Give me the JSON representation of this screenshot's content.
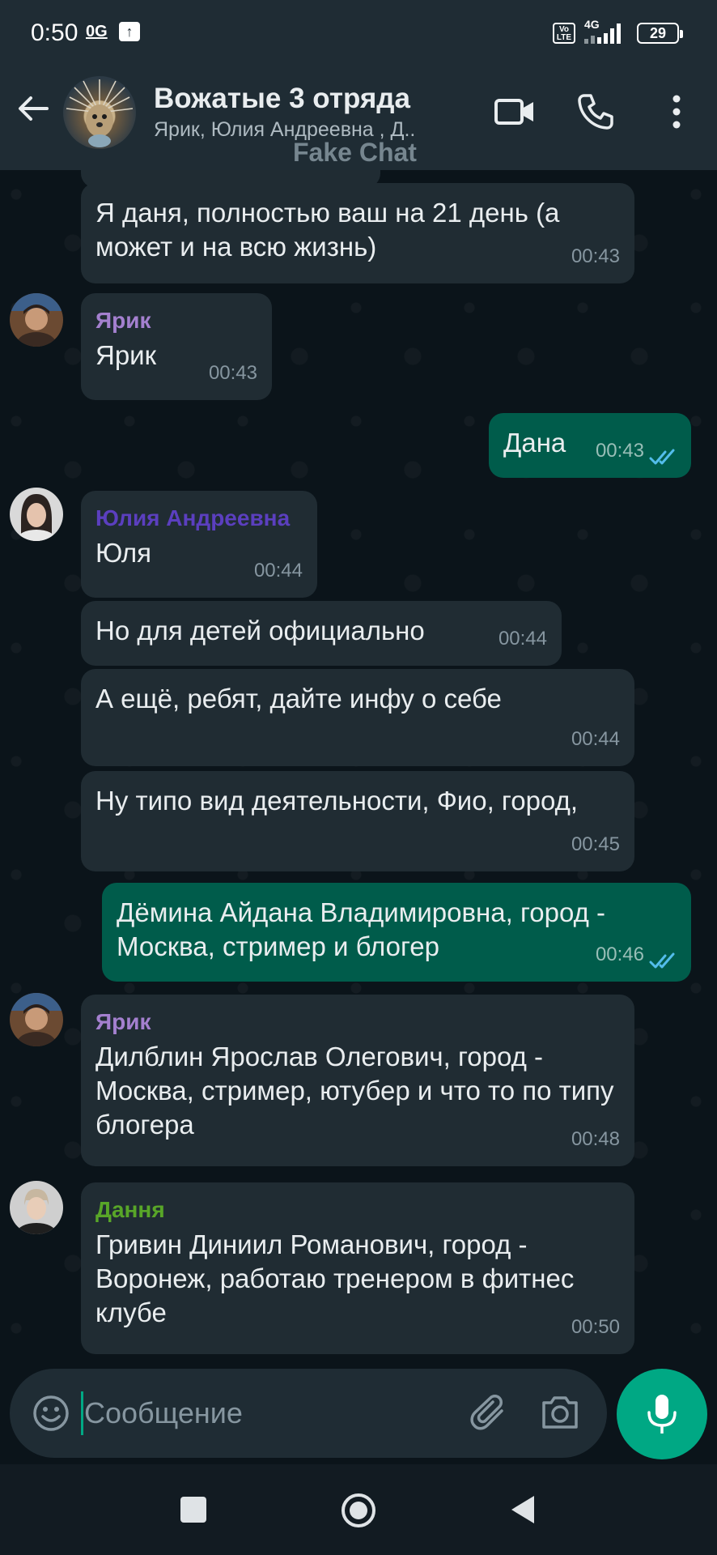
{
  "status_bar": {
    "time": "0:50",
    "og": "0G",
    "network": "4G",
    "volte": "Vo LTE",
    "battery": "29"
  },
  "header": {
    "title": "Вожатые 3 отряда",
    "members": "Ярик, Юлия Андреевна , Д..",
    "watermark": "Fake Chat"
  },
  "colors": {
    "incoming_bubble": "#202c33",
    "outgoing_bubble": "#005c4b",
    "accent": "#00a884",
    "sender_yarik": "#a480cf",
    "sender_yulia": "#5b3fbf",
    "sender_dannya": "#58a628"
  },
  "messages": [
    {
      "dir": "in",
      "text": "Я даня, полностью ваш на 21 день (а может и на всю жизнь)",
      "time": "00:43"
    },
    {
      "dir": "in",
      "sender": "Ярик",
      "text": "Ярик",
      "time": "00:43"
    },
    {
      "dir": "out",
      "text": "Дана",
      "time": "00:43"
    },
    {
      "dir": "in",
      "sender": "Юлия Андреевна",
      "text": "Юля",
      "time": "00:44"
    },
    {
      "dir": "in",
      "text": "Но для детей официально",
      "time": "00:44"
    },
    {
      "dir": "in",
      "text": "А ещё, ребят, дайте инфу о себе",
      "time": "00:44"
    },
    {
      "dir": "in",
      "text": "Ну типо вид деятельности, Фио, город,",
      "time": "00:45"
    },
    {
      "dir": "out",
      "text": "Дёмина Айдана Владимировна, город - Москва, стример и блогер",
      "time": "00:46"
    },
    {
      "dir": "in",
      "sender": "Ярик",
      "text": "Дилблин Ярослав Олегович, город - Москва, стример, ютубер и что то по типу блогера",
      "time": "00:48"
    },
    {
      "dir": "in",
      "sender": "Дання",
      "text": "Гривин Диниил Романович, город - Воронеж, работаю тренером в фитнес клубе",
      "time": "00:50"
    }
  ],
  "input": {
    "placeholder": "Сообщение"
  },
  "icons": [
    "back-arrow-icon",
    "video-call-icon",
    "phone-icon",
    "more-vert-icon",
    "emoji-icon",
    "paperclip-icon",
    "camera-icon",
    "microphone-icon",
    "double-check-icon"
  ]
}
